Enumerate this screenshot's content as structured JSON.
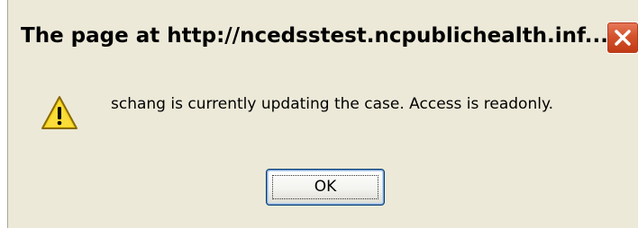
{
  "dialog": {
    "title": "The page at http://ncedsstest.ncpublichealth.inf...",
    "message": "schang is currently updating the case. Access is readonly.",
    "ok_label": "OK",
    "icon": "warning-icon",
    "close_icon": "close-icon"
  },
  "colors": {
    "dialog_bg": "#ece9d8",
    "close_button": "#d3532d",
    "warning_fill": "#f5d21c"
  }
}
